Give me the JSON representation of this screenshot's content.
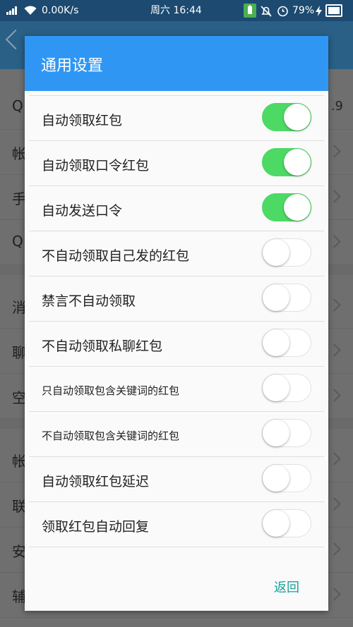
{
  "status_bar": {
    "network_speed": "0.00K/s",
    "day_time": "周六 16:44",
    "battery": "79%"
  },
  "background": {
    "rows": [
      {
        "text": "Q",
        "right": ".9"
      },
      {
        "text": "帐",
        "right": ""
      },
      {
        "text": "手",
        "right": ""
      },
      {
        "text": "Q",
        "right": ""
      },
      {
        "text": "消",
        "right": ""
      },
      {
        "text": "聊",
        "right": ""
      },
      {
        "text": "空",
        "right": ""
      },
      {
        "text": "帐",
        "right": ""
      },
      {
        "text": "联",
        "right": ""
      },
      {
        "text": "安",
        "right": ""
      },
      {
        "text": "辅",
        "right": ""
      }
    ]
  },
  "dialog": {
    "title": "通用设置",
    "settings": [
      {
        "label": "自动领取红包",
        "on": true
      },
      {
        "label": "自动领取口令红包",
        "on": true
      },
      {
        "label": "自动发送口令",
        "on": true
      },
      {
        "label": "不自动领取自己发的红包",
        "on": false
      },
      {
        "label": "禁言不自动领取",
        "on": false
      },
      {
        "label": "不自动领取私聊红包",
        "on": false
      },
      {
        "label": "只自动领取包含关键词的红包",
        "on": false
      },
      {
        "label": "不自动领取包含关键词的红包",
        "on": false
      },
      {
        "label": "自动领取红包延迟",
        "on": false
      },
      {
        "label": "领取红包自动回复",
        "on": false
      }
    ],
    "back_label": "返回"
  },
  "colors": {
    "accent": "#2f97f3",
    "toggle_on": "#4cd964",
    "back_text": "#17a098"
  }
}
